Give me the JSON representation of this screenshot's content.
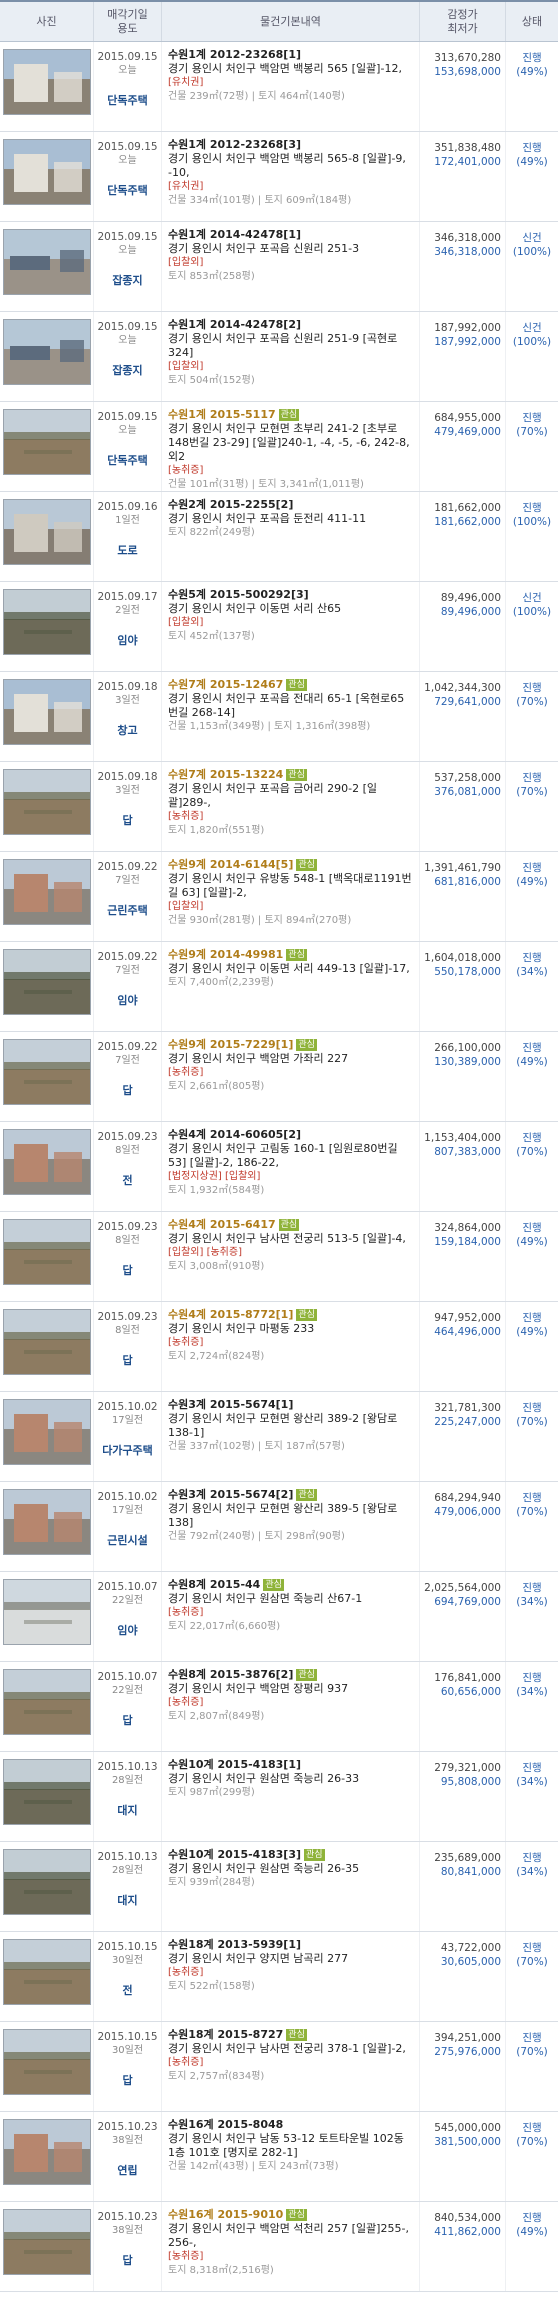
{
  "header": {
    "photo": "사진",
    "date": [
      "매각기일",
      "용도"
    ],
    "info": "물건기본내역",
    "price": [
      "감정가",
      "최저가"
    ],
    "status": "상태"
  },
  "rows": [
    {
      "date": "2015.09.15",
      "session": "오늘",
      "use": "단독주택",
      "case": "수원1계 2012-23268[1]",
      "tag": "",
      "addr": "경기 용인시 처인구 백암면 백봉리 565 [일괄]-12,",
      "flags": "[유치권]",
      "area": "건물 239㎡(72평) | 토지 464㎡(140평)",
      "appraisal": "313,670,280",
      "minimum": "153,698,000",
      "status": "진행",
      "ratio": "(49%)",
      "hl": false,
      "thumb": "house"
    },
    {
      "date": "2015.09.15",
      "session": "오늘",
      "use": "단독주택",
      "case": "수원1계 2012-23268[3]",
      "tag": "",
      "addr": "경기 용인시 처인구 백암면 백봉리 565-8 [일괄]-9, -10,",
      "flags": "[유치권]",
      "area": "건물 334㎡(101평) | 토지 609㎡(184평)",
      "appraisal": "351,838,480",
      "minimum": "172,401,000",
      "status": "진행",
      "ratio": "(49%)",
      "hl": false,
      "thumb": "house"
    },
    {
      "date": "2015.09.15",
      "session": "오늘",
      "use": "잡종지",
      "case": "수원1계 2014-42478[1]",
      "tag": "",
      "addr": "경기 용인시 처인구 포곡읍 신원리 251-3",
      "flags": "[입찰외]",
      "area": "토지 853㎡(258평)",
      "appraisal": "346,318,000",
      "minimum": "346,318,000",
      "status": "신건",
      "ratio": "(100%)",
      "hl": false,
      "thumb": "yard"
    },
    {
      "date": "2015.09.15",
      "session": "오늘",
      "use": "잡종지",
      "case": "수원1계 2014-42478[2]",
      "tag": "",
      "addr": "경기 용인시 처인구 포곡읍 신원리 251-9 [곡현로 324]",
      "flags": "[입찰외]",
      "area": "토지 504㎡(152평)",
      "appraisal": "187,992,000",
      "minimum": "187,992,000",
      "status": "신건",
      "ratio": "(100%)",
      "hl": false,
      "thumb": "yard"
    },
    {
      "date": "2015.09.15",
      "session": "오늘",
      "use": "단독주택",
      "case": "수원1계 2015-5117",
      "tag": "관심",
      "addr": "경기 용인시 처인구 모현면 초부리 241-2 [초부로148번길 23-29] [일괄]240-1, -4, -5, -6, 242-8, 외2",
      "flags": "[농취증]",
      "area": "건물 101㎡(31평) | 토지 3,341㎡(1,011평)",
      "appraisal": "684,955,000",
      "minimum": "479,469,000",
      "status": "진행",
      "ratio": "(70%)",
      "hl": true,
      "thumb": "field"
    },
    {
      "date": "2015.09.16",
      "session": "1일전",
      "use": "도로",
      "case": "수원2계 2015-2255[2]",
      "tag": "",
      "addr": "경기 용인시 처인구 포곡읍 둔전리 411-11",
      "flags": "",
      "area": "토지 822㎡(249평)",
      "appraisal": "181,662,000",
      "minimum": "181,662,000",
      "status": "진행",
      "ratio": "(100%)",
      "hl": false,
      "thumb": "town"
    },
    {
      "date": "2015.09.17",
      "session": "2일전",
      "use": "임야",
      "case": "수원5계 2015-500292[3]",
      "tag": "",
      "addr": "경기 용인시 처인구 이동면 서리 산65",
      "flags": "[입찰외]",
      "area": "토지 452㎡(137평)",
      "appraisal": "89,496,000",
      "minimum": "89,496,000",
      "status": "신건",
      "ratio": "(100%)",
      "hl": false,
      "thumb": "forest"
    },
    {
      "date": "2015.09.18",
      "session": "3일전",
      "use": "창고",
      "case": "수원7계 2015-12467",
      "tag": "관심",
      "addr": "경기 용인시 처인구 포곡읍 전대리 65-1 [옥현로65번길 268-14]",
      "flags": "",
      "area": "건물 1,153㎡(349평) | 토지 1,316㎡(398평)",
      "appraisal": "1,042,344,300",
      "minimum": "729,641,000",
      "status": "진행",
      "ratio": "(70%)",
      "hl": true,
      "thumb": "house"
    },
    {
      "date": "2015.09.18",
      "session": "3일전",
      "use": "답",
      "case": "수원7계 2015-13224",
      "tag": "관심",
      "addr": "경기 용인시 처인구 포곡읍 금어리 290-2 [일괄]289-,",
      "flags": "[농취증]",
      "area": "토지 1,820㎡(551평)",
      "appraisal": "537,258,000",
      "minimum": "376,081,000",
      "status": "진행",
      "ratio": "(70%)",
      "hl": true,
      "thumb": "field"
    },
    {
      "date": "2015.09.22",
      "session": "7일전",
      "use": "근린주택",
      "case": "수원9계 2014-6144[5]",
      "tag": "관심",
      "addr": "경기 용인시 처인구 유방동 548-1 [백옥대로1191번길 63] [일괄]-2,",
      "flags": "[입찰외]",
      "area": "건물 930㎡(281평) | 토지 894㎡(270평)",
      "appraisal": "1,391,461,790",
      "minimum": "681,816,000",
      "status": "진행",
      "ratio": "(49%)",
      "hl": true,
      "thumb": "building"
    },
    {
      "date": "2015.09.22",
      "session": "7일전",
      "use": "임야",
      "case": "수원9계 2014-49981",
      "tag": "관심",
      "addr": "경기 용인시 처인구 이동면 서리 449-13 [일괄]-17,",
      "flags": "",
      "area": "토지 7,400㎡(2,239평)",
      "appraisal": "1,604,018,000",
      "minimum": "550,178,000",
      "status": "진행",
      "ratio": "(34%)",
      "hl": true,
      "thumb": "forest"
    },
    {
      "date": "2015.09.22",
      "session": "7일전",
      "use": "답",
      "case": "수원9계 2015-7229[1]",
      "tag": "관심",
      "addr": "경기 용인시 처인구 백암면 가좌리 227",
      "flags": "[농취증]",
      "area": "토지 2,661㎡(805평)",
      "appraisal": "266,100,000",
      "minimum": "130,389,000",
      "status": "진행",
      "ratio": "(49%)",
      "hl": true,
      "thumb": "field"
    },
    {
      "date": "2015.09.23",
      "session": "8일전",
      "use": "전",
      "case": "수원4계 2014-60605[2]",
      "tag": "",
      "addr": "경기 용인시 처인구 고림동 160-1 [임원로80번길 53] [일괄]-2, 186-22,",
      "flags": "[법정지상권] [입찰외]",
      "area": "토지 1,932㎡(584평)",
      "appraisal": "1,153,404,000",
      "minimum": "807,383,000",
      "status": "진행",
      "ratio": "(70%)",
      "hl": false,
      "thumb": "building"
    },
    {
      "date": "2015.09.23",
      "session": "8일전",
      "use": "답",
      "case": "수원4계 2015-6417",
      "tag": "관심",
      "addr": "경기 용인시 처인구 남사면 전궁리 513-5 [일괄]-4,",
      "flags": "[입찰외] [농취증]",
      "area": "토지 3,008㎡(910평)",
      "appraisal": "324,864,000",
      "minimum": "159,184,000",
      "status": "진행",
      "ratio": "(49%)",
      "hl": true,
      "thumb": "field"
    },
    {
      "date": "2015.09.23",
      "session": "8일전",
      "use": "답",
      "case": "수원4계 2015-8772[1]",
      "tag": "관심",
      "addr": "경기 용인시 처인구 마평동 233",
      "flags": "[농취증]",
      "area": "토지 2,724㎡(824평)",
      "appraisal": "947,952,000",
      "minimum": "464,496,000",
      "status": "진행",
      "ratio": "(49%)",
      "hl": true,
      "thumb": "field"
    },
    {
      "date": "2015.10.02",
      "session": "17일전",
      "use": "다가구주택",
      "case": "수원3계 2015-5674[1]",
      "tag": "",
      "addr": "경기 용인시 처인구 모현면 왕산리 389-2 [왕담로 138-1]",
      "flags": "",
      "area": "건물 337㎡(102평) | 토지 187㎡(57평)",
      "appraisal": "321,781,300",
      "minimum": "225,247,000",
      "status": "진행",
      "ratio": "(70%)",
      "hl": false,
      "thumb": "building"
    },
    {
      "date": "2015.10.02",
      "session": "17일전",
      "use": "근린시설",
      "case": "수원3계 2015-5674[2]",
      "tag": "관심",
      "addr": "경기 용인시 처인구 모현면 왕산리 389-5 [왕담로 138]",
      "flags": "",
      "area": "건물 792㎡(240평) | 토지 298㎡(90평)",
      "appraisal": "684,294,940",
      "minimum": "479,006,000",
      "status": "진행",
      "ratio": "(70%)",
      "hl": false,
      "thumb": "building"
    },
    {
      "date": "2015.10.07",
      "session": "22일전",
      "use": "임야",
      "case": "수원8계 2015-44",
      "tag": "관심",
      "addr": "경기 용인시 처인구 원삼면 죽능리 산67-1",
      "flags": "[농취증]",
      "area": "토지 22,017㎡(6,660평)",
      "appraisal": "2,025,564,000",
      "minimum": "694,769,000",
      "status": "진행",
      "ratio": "(34%)",
      "hl": false,
      "thumb": "snow"
    },
    {
      "date": "2015.10.07",
      "session": "22일전",
      "use": "답",
      "case": "수원8계 2015-3876[2]",
      "tag": "관심",
      "addr": "경기 용인시 처인구 백암면 장평리 937",
      "flags": "[농취증]",
      "area": "토지 2,807㎡(849평)",
      "appraisal": "176,841,000",
      "minimum": "60,656,000",
      "status": "진행",
      "ratio": "(34%)",
      "hl": false,
      "thumb": "field"
    },
    {
      "date": "2015.10.13",
      "session": "28일전",
      "use": "대지",
      "case": "수원10계 2015-4183[1]",
      "tag": "",
      "addr": "경기 용인시 처인구 원삼면 죽능리 26-33",
      "flags": "",
      "area": "토지 987㎡(299평)",
      "appraisal": "279,321,000",
      "minimum": "95,808,000",
      "status": "진행",
      "ratio": "(34%)",
      "hl": false,
      "thumb": "forest"
    },
    {
      "date": "2015.10.13",
      "session": "28일전",
      "use": "대지",
      "case": "수원10계 2015-4183[3]",
      "tag": "관심",
      "addr": "경기 용인시 처인구 원삼면 죽능리 26-35",
      "flags": "",
      "area": "토지 939㎡(284평)",
      "appraisal": "235,689,000",
      "minimum": "80,841,000",
      "status": "진행",
      "ratio": "(34%)",
      "hl": false,
      "thumb": "forest"
    },
    {
      "date": "2015.10.15",
      "session": "30일전",
      "use": "전",
      "case": "수원18계 2013-5939[1]",
      "tag": "",
      "addr": "경기 용인시 처인구 양지면 남곡리 277",
      "flags": "[농취증]",
      "area": "토지 522㎡(158평)",
      "appraisal": "43,722,000",
      "minimum": "30,605,000",
      "status": "진행",
      "ratio": "(70%)",
      "hl": false,
      "thumb": "field"
    },
    {
      "date": "2015.10.15",
      "session": "30일전",
      "use": "답",
      "case": "수원18계 2015-8727",
      "tag": "관심",
      "addr": "경기 용인시 처인구 남사면 전궁리 378-1 [일괄]-2,",
      "flags": "[농취증]",
      "area": "토지 2,757㎡(834평)",
      "appraisal": "394,251,000",
      "minimum": "275,976,000",
      "status": "진행",
      "ratio": "(70%)",
      "hl": false,
      "thumb": "field"
    },
    {
      "date": "2015.10.23",
      "session": "38일전",
      "use": "연립",
      "case": "수원16계 2015-8048",
      "tag": "",
      "addr": "경기 용인시 처인구 남동 53-12 토트타운빌 102동 1층 101호 [명지로 282-1]",
      "flags": "",
      "area": "건물 142㎡(43평) | 토지 243㎡(73평)",
      "appraisal": "545,000,000",
      "minimum": "381,500,000",
      "status": "진행",
      "ratio": "(70%)",
      "hl": false,
      "thumb": "building"
    },
    {
      "date": "2015.10.23",
      "session": "38일전",
      "use": "답",
      "case": "수원16계 2015-9010",
      "tag": "관심",
      "addr": "경기 용인시 처인구 백암면 석천리 257 [일괄]255-, 256-,",
      "flags": "[농취증]",
      "area": "토지 8,318㎡(2,516평)",
      "appraisal": "840,534,000",
      "minimum": "411,862,000",
      "status": "진행",
      "ratio": "(49%)",
      "hl": true,
      "thumb": "field"
    }
  ],
  "thumb_palettes": {
    "house": {
      "sky": "#a9bed3",
      "land": "#8a8275",
      "block": "#e3e0d8"
    },
    "yard": {
      "sky": "#b5c7d6",
      "land": "#9a9288",
      "block": "#5c6b7d"
    },
    "field": {
      "sky": "#c4cfd8",
      "land": "#8d7b61",
      "block": "#6b6a4e"
    },
    "town": {
      "sky": "#b9c8d6",
      "land": "#857d73",
      "block": "#cfcac0"
    },
    "forest": {
      "sky": "#c2cdd4",
      "land": "#6d6a58",
      "block": "#4f5640"
    },
    "building": {
      "sky": "#bcc9d6",
      "land": "#8b8780",
      "block": "#b7866e"
    },
    "snow": {
      "sky": "#cfd8df",
      "land": "#d9dcdc",
      "block": "#7a7c70"
    }
  }
}
